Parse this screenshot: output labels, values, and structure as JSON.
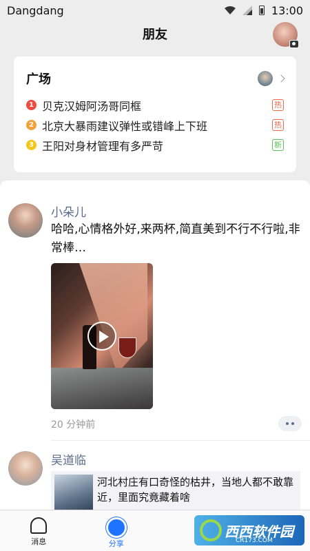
{
  "status_bar": {
    "carrier": "Dangdang",
    "time": "13:00"
  },
  "header": {
    "title": "朋友"
  },
  "square": {
    "title": "广场",
    "items": [
      {
        "rank": "1",
        "rank_color": "#f04b3c",
        "text": "贝克汉姆阿汤哥同框",
        "tag": "热",
        "tag_color": "#f06a4a"
      },
      {
        "rank": "2",
        "rank_color": "#f3a13a",
        "text": "北京大暴雨建议弹性或错峰上下班",
        "tag": "热",
        "tag_color": "#f06a4a"
      },
      {
        "rank": "3",
        "rank_color": "#f5c518",
        "text": "王阳对身材管理有多严苛",
        "tag": "新",
        "tag_color": "#5ac05a"
      }
    ]
  },
  "feed": {
    "posts": [
      {
        "name": "小朵儿",
        "text": "哈哈,心情格外好,来两杯,简直美到不行不行啦,非常棒…",
        "time": "20 分钟前"
      },
      {
        "name": "吴道临",
        "link_text": "河北村庄有口奇怪的枯井，当地人都不敢靠近，里面究竟藏着啥"
      }
    ]
  },
  "tabs": [
    {
      "label": "消息",
      "icon": "bell-icon"
    },
    {
      "label": "分享",
      "icon": "sun-icon",
      "active": true
    },
    {
      "label": "",
      "icon": "people-icon"
    },
    {
      "label": "",
      "icon": "person-icon"
    }
  ],
  "watermark": {
    "text": "西西软件园",
    "subtext": "CR173.COM"
  }
}
